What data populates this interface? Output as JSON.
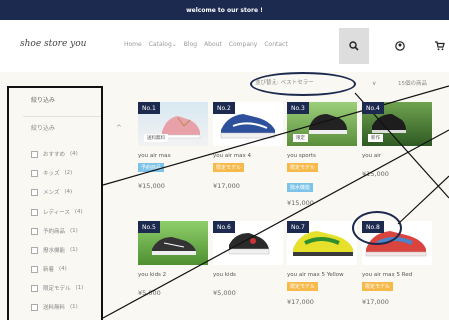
{
  "topbar": {
    "text": "welcome to our store !"
  },
  "header": {
    "logo": "shoe store you",
    "nav": [
      "Home",
      "Catalog",
      "Blog",
      "About",
      "Company",
      "Contact"
    ],
    "catalog_caret": "⌄",
    "icons": {
      "search": "search-icon",
      "user": "user-icon",
      "cart": "cart-icon"
    }
  },
  "sidebar": {
    "title": "絞り込み",
    "refine_label": "絞り込み",
    "collapse_icon": "^",
    "filters": [
      {
        "label": "おすすめ",
        "count": "(4)"
      },
      {
        "label": "キッズ",
        "count": "(2)"
      },
      {
        "label": "メンズ",
        "count": "(4)"
      },
      {
        "label": "レディース",
        "count": "(4)"
      },
      {
        "label": "予約商品",
        "count": "(1)"
      },
      {
        "label": "撥水機能",
        "count": "(1)"
      },
      {
        "label": "新着",
        "count": "(4)"
      },
      {
        "label": "限定モデル",
        "count": "(1)"
      },
      {
        "label": "送料無料",
        "count": "(1)"
      }
    ]
  },
  "toolbar": {
    "sort_label": "並び替え:",
    "sort_value": "ベストセラー",
    "sort_caret": "∨",
    "item_count": "15個の商品"
  },
  "products": [
    {
      "rank": "No.1",
      "name": "you air max",
      "badge": "予約商品",
      "badge_color": "#7cc3e9",
      "badge2": "",
      "price": "¥15,000",
      "image_tag": "送料無料"
    },
    {
      "rank": "No.2",
      "name": "you air max 4",
      "badge": "限定モデル",
      "badge_color": "#f6b94a",
      "badge2": "",
      "price": "¥17,000",
      "image_tag": ""
    },
    {
      "rank": "No.3",
      "name": "you sports",
      "badge": "限定モデル",
      "badge_color": "#f6b94a",
      "badge2": "撥水機能",
      "price": "¥15,000",
      "image_tag": "限定"
    },
    {
      "rank": "No.4",
      "name": "you air",
      "badge": "",
      "badge_color": "",
      "badge2": "",
      "price": "¥15,000",
      "image_tag": "新作"
    },
    {
      "rank": "No.5",
      "name": "you kids 2",
      "badge": "",
      "badge_color": "",
      "badge2": "",
      "price": "¥5,000",
      "image_tag": ""
    },
    {
      "rank": "No.6",
      "name": "you kids",
      "badge": "",
      "badge_color": "",
      "badge2": "",
      "price": "¥5,000",
      "image_tag": ""
    },
    {
      "rank": "No.7",
      "name": "you air max 5 Yellow",
      "badge": "限定モデル",
      "badge_color": "#f6b94a",
      "badge2": "",
      "price": "¥17,000",
      "image_tag": ""
    },
    {
      "rank": "No.8",
      "name": "you air max 5 Red",
      "badge": "限定モデル",
      "badge_color": "#f6b94a",
      "badge2": "",
      "price": "¥17,000",
      "image_tag": ""
    }
  ]
}
